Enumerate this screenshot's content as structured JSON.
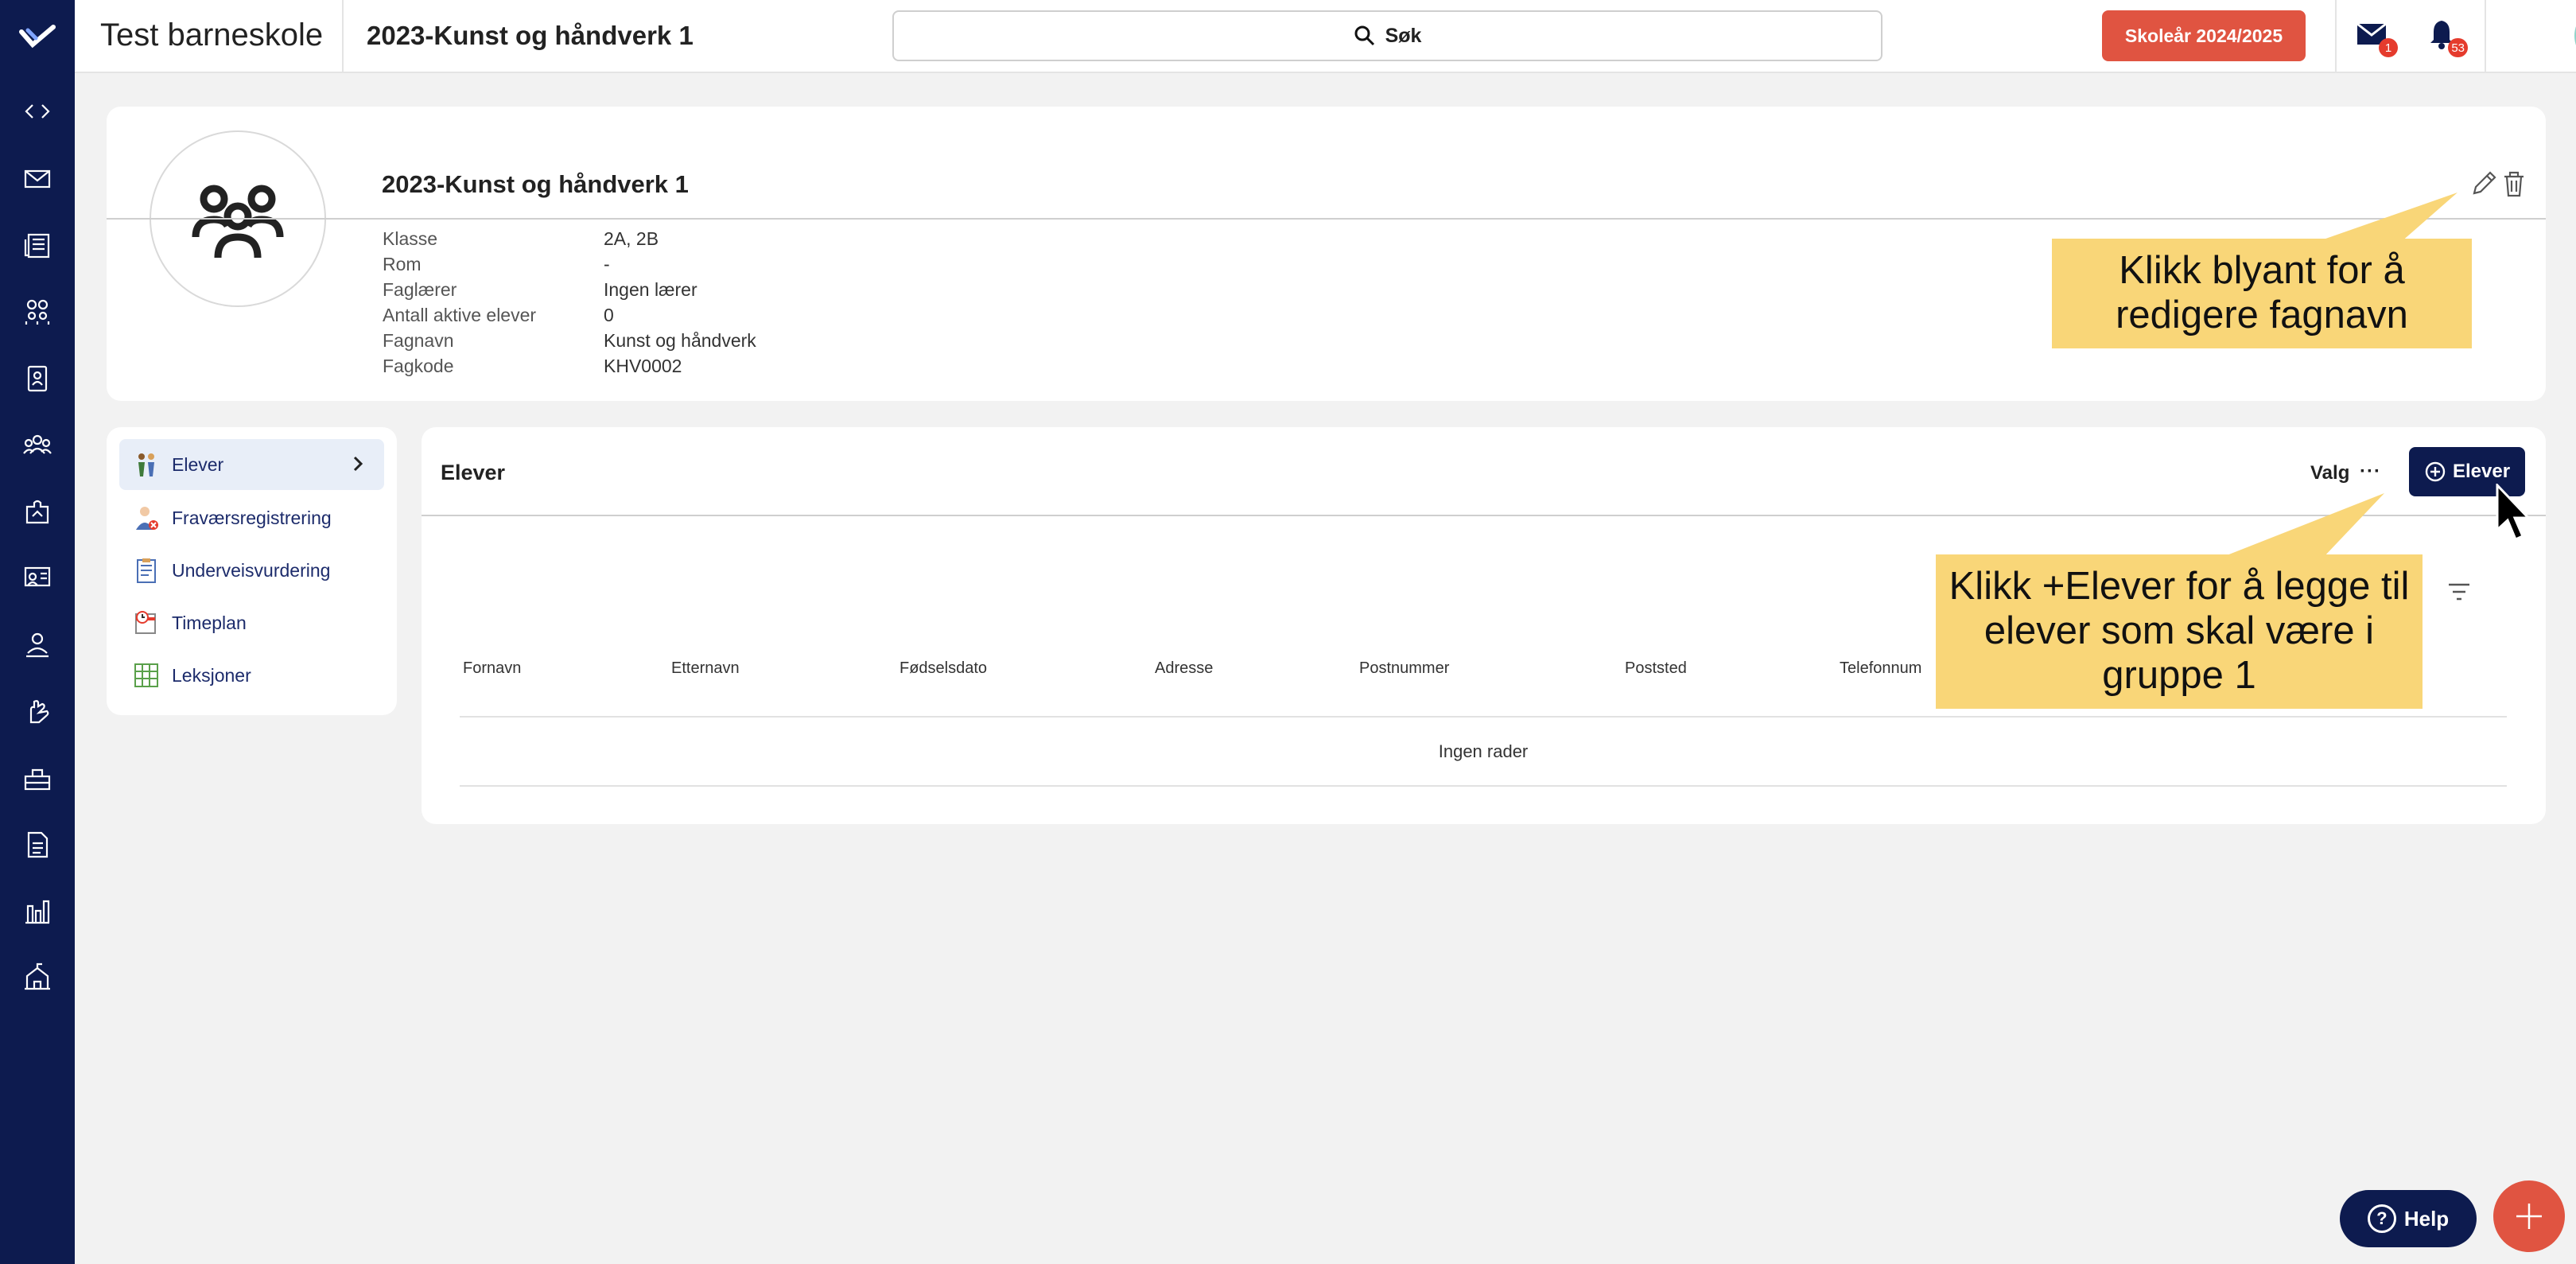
{
  "topbar": {
    "school_name": "Test barneskole",
    "page_title": "2023-Kunst og håndverk 1",
    "search_label": "Søk",
    "school_year_button": "Skoleår 2024/2025",
    "messages_badge": "1",
    "notifications_badge": "53"
  },
  "sidebar": {
    "icons": [
      "logo-icon",
      "code-icon",
      "mail-icon",
      "news-icon",
      "groups-icon",
      "id-card-icon",
      "people-icon",
      "puzzle-icon",
      "classroom-icon",
      "teacher-icon",
      "hand-icon",
      "desk-icon",
      "document-icon",
      "chart-icon",
      "school-icon"
    ]
  },
  "info": {
    "title": "2023-Kunst og håndverk 1",
    "rows": [
      {
        "label": "Klasse",
        "value": "2A, 2B"
      },
      {
        "label": "Rom",
        "value": "-"
      },
      {
        "label": "Faglærer",
        "value": "Ingen lærer"
      },
      {
        "label": "Antall aktive elever",
        "value": "0"
      },
      {
        "label": "Fagnavn",
        "value": "Kunst og håndverk"
      },
      {
        "label": "Fagkode",
        "value": "KHV0002"
      }
    ]
  },
  "menu": {
    "items": [
      {
        "label": "Elever",
        "icon": "students-icon",
        "active": true
      },
      {
        "label": "Fraværsregistrering",
        "icon": "absence-icon",
        "active": false
      },
      {
        "label": "Underveisvurdering",
        "icon": "assessment-icon",
        "active": false
      },
      {
        "label": "Timeplan",
        "icon": "timetable-icon",
        "active": false
      },
      {
        "label": "Leksjoner",
        "icon": "lessons-icon",
        "active": false
      }
    ]
  },
  "elever": {
    "title": "Elever",
    "valg_label": "Valg",
    "more_label": "···",
    "add_button": "Elever",
    "columns": [
      "Fornavn",
      "Etternavn",
      "Fødselsdato",
      "Adresse",
      "Postnummer",
      "Poststed",
      "Telefonnum"
    ],
    "empty_text": "Ingen rader"
  },
  "callouts": {
    "edit_hint": "Klikk blyant for å redigere fagnavn",
    "add_hint": "Klikk +Elever for å legge til elever som skal være i gruppe 1"
  },
  "footer": {
    "help_label": "Help"
  },
  "colors": {
    "sidebar": "#0d1b4f",
    "accent_red": "#e05441",
    "callout": "#f9d678",
    "active_menu": "#e8eef8"
  }
}
